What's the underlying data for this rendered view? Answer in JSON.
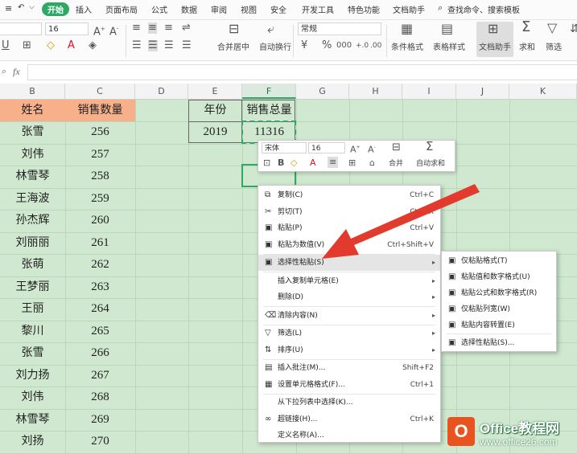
{
  "menu_tabs": [
    "开始",
    "插入",
    "页面布局",
    "公式",
    "数据",
    "审阅",
    "视图",
    "安全",
    "开发工具",
    "特色功能",
    "文档助手"
  ],
  "search_label": "查找命令、搜索模板",
  "ribbon": {
    "font_size": "16",
    "number_format": "常规",
    "merge_label": "合并居中",
    "wrap_label": "自动换行",
    "cond_format": "条件格式",
    "table_style": "表格样式",
    "doc_helper": "文档助手",
    "sum": "求和",
    "filter": "筛选"
  },
  "formula_bar": {
    "fx": "fx"
  },
  "columns": [
    "B",
    "C",
    "D",
    "E",
    "F",
    "G",
    "H",
    "I",
    "J",
    "K"
  ],
  "table": {
    "header_name": "姓名",
    "header_qty": "销售数量",
    "names": [
      "张雪",
      "刘伟",
      "林雪琴",
      "王海波",
      "孙杰辉",
      "刘丽丽",
      "张萌",
      "王梦丽",
      "王丽",
      "黎川",
      "张雪",
      "刘力扬",
      "刘伟",
      "林雪琴",
      "刘扬"
    ],
    "qty": [
      "256",
      "257",
      "258",
      "259",
      "260",
      "261",
      "262",
      "263",
      "264",
      "265",
      "266",
      "267",
      "268",
      "269",
      "270"
    ]
  },
  "summary": {
    "year_label": "年份",
    "total_label": "销售总量",
    "year": "2019",
    "total": "11316"
  },
  "mini_toolbar": {
    "font": "宋体",
    "size": "16",
    "merge": "合并",
    "autosum": "自动求和"
  },
  "context_menu": [
    {
      "label": "复制(C)",
      "shortcut": "Ctrl+C",
      "icon": "copy-icon"
    },
    {
      "label": "剪切(T)",
      "shortcut": "Ctrl+X",
      "icon": "scissors-icon"
    },
    {
      "label": "粘贴(P)",
      "shortcut": "Ctrl+V",
      "icon": "paste-icon"
    },
    {
      "label": "粘贴为数值(V)",
      "shortcut": "Ctrl+Shift+V",
      "icon": "paste-values-icon"
    },
    {
      "label": "选择性粘贴(S)",
      "shortcut": "",
      "icon": "paste-special-icon",
      "submenu": true,
      "highlight": true
    },
    {
      "label": "插入复制单元格(E)",
      "shortcut": "",
      "icon": "",
      "submenu": true
    },
    {
      "label": "删除(D)",
      "shortcut": "",
      "icon": "",
      "submenu": true
    },
    {
      "label": "清除内容(N)",
      "shortcut": "",
      "icon": "eraser-icon",
      "submenu": true
    },
    {
      "label": "筛选(L)",
      "shortcut": "",
      "icon": "filter-icon",
      "submenu": true
    },
    {
      "label": "排序(U)",
      "shortcut": "",
      "icon": "sort-icon",
      "submenu": true
    },
    {
      "label": "插入批注(M)...",
      "shortcut": "Shift+F2",
      "icon": "comment-icon"
    },
    {
      "label": "设置单元格格式(F)...",
      "shortcut": "Ctrl+1",
      "icon": "format-cells-icon"
    },
    {
      "label": "从下拉列表中选择(K)...",
      "shortcut": "",
      "icon": ""
    },
    {
      "label": "超链接(H)...",
      "shortcut": "Ctrl+K",
      "icon": "link-icon"
    },
    {
      "label": "定义名称(A)...",
      "shortcut": "",
      "icon": ""
    }
  ],
  "submenu": [
    "仅粘贴格式(T)",
    "粘贴值和数字格式(U)",
    "粘贴公式和数字格式(R)",
    "仅粘贴列宽(W)",
    "粘贴内容转置(E)",
    "选择性粘贴(S)..."
  ],
  "watermark": {
    "brand": "Office教程网",
    "url": "www.office26.com"
  },
  "colors": {
    "accent": "#2ea865",
    "header_fill": "#f7b08a",
    "grid_bg": "#cfe8cf",
    "arrow": "#e23b2e",
    "logo": "#e8531f"
  }
}
